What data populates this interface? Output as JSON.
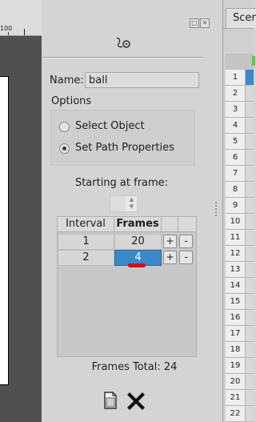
{
  "canvas": {
    "ruler_label": "100"
  },
  "panel": {
    "float_icon": "float-window-icon",
    "close_icon": "close-icon",
    "tool_icon": "motion-path-icon",
    "name_label": "Name:",
    "name_value": "ball",
    "options_label": "Options",
    "options": [
      {
        "label": "Select Object",
        "checked": false
      },
      {
        "label": "Set Path Properties",
        "checked": true
      }
    ],
    "starting_frame_label": "Starting at frame:",
    "starting_frame_value": "",
    "table": {
      "headers": [
        "Interval",
        "Frames",
        "",
        ""
      ],
      "rows": [
        {
          "interval": "1",
          "frames": "20",
          "plus": "+",
          "minus": "-"
        },
        {
          "interval": "2",
          "frames": "4",
          "plus": "+",
          "minus": "-",
          "selected": true
        }
      ]
    },
    "frames_total": "Frames Total: 24",
    "doc_icon": "document-icon",
    "x_icon": "close-x-icon"
  },
  "sheet": {
    "tab_label": "Scen",
    "row_numbers": [
      "1",
      "2",
      "3",
      "4",
      "5",
      "6",
      "7",
      "8",
      "9",
      "10",
      "11",
      "12",
      "13",
      "14",
      "15",
      "16",
      "17",
      "18",
      "19",
      "20",
      "21",
      "22"
    ],
    "selection_color": "#3b88c9"
  }
}
